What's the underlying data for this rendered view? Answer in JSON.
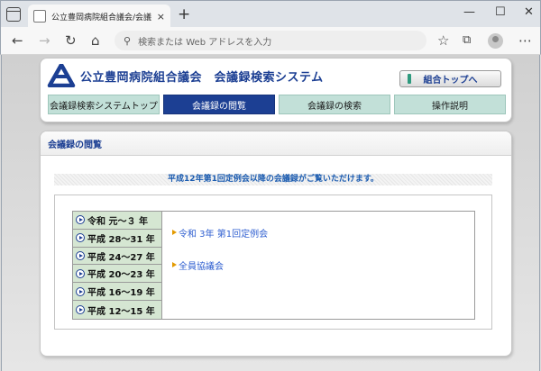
{
  "browser": {
    "tab_title": "公立豊岡病院組合議会/会議録検",
    "tab_close": "×",
    "new_tab": "+",
    "address_placeholder": "検索または Web アドレスを入力"
  },
  "site": {
    "title": "公立豊岡病院組合議会　会議録検索システム",
    "top_button": "組合トップへ",
    "nav": [
      "会議録検索システムトップ",
      "会議録の閲覧",
      "会議録の検索",
      "操作説明"
    ],
    "active_nav_index": 1
  },
  "main": {
    "heading": "会議録の閲覧",
    "notice": "平成12年第1回定例会以降の会議録がご覧いただけます。",
    "eras": [
      "令和 元～３ 年",
      "平成 28～31 年",
      "平成 24～27 年",
      "平成 20～23 年",
      "平成 16～19 年",
      "平成 12～15 年"
    ],
    "meetings": [
      "令和 3年 第1回定例会",
      "全員協議会"
    ]
  },
  "colors": {
    "brand_navy": "#1c3f93",
    "nav_mint": "#c2e0d8",
    "era_green": "#d5e6d2",
    "link_blue": "#2f5fd0",
    "bullet_orange": "#e39a00"
  }
}
